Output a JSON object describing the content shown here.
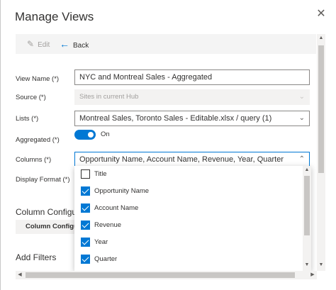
{
  "dialog": {
    "title": "Manage Views",
    "close_icon": "close-icon"
  },
  "toolbar": {
    "edit_label": "Edit",
    "back_label": "Back"
  },
  "form": {
    "view_name": {
      "label": "View Name (*)",
      "value": "NYC and Montreal Sales - Aggregated"
    },
    "source": {
      "label": "Source (*)",
      "value": "Sites in current Hub"
    },
    "lists": {
      "label": "Lists (*)",
      "value": "Montreal Sales, Toronto Sales - Editable.xlsx / query (1)"
    },
    "aggregated": {
      "label": "Aggregated (*)",
      "state": "On"
    },
    "columns": {
      "label": "Columns (*)",
      "value": "Opportunity Name, Account Name, Revenue, Year, Quarter"
    },
    "display_format": {
      "label": "Display Format (*)"
    }
  },
  "sections": {
    "column_config_heading": "Column Configu",
    "column_config_button": "Column Configu",
    "add_filters_heading": "Add Filters"
  },
  "columns_dropdown": {
    "options": [
      {
        "label": "Title",
        "checked": false
      },
      {
        "label": "Opportunity Name",
        "checked": true
      },
      {
        "label": "Account Name",
        "checked": true
      },
      {
        "label": "Revenue",
        "checked": true
      },
      {
        "label": "Year",
        "checked": true
      },
      {
        "label": "Quarter",
        "checked": true
      }
    ]
  },
  "colors": {
    "accent": "#0078d4",
    "text": "#323130",
    "disabled_text": "#a19f9d"
  }
}
